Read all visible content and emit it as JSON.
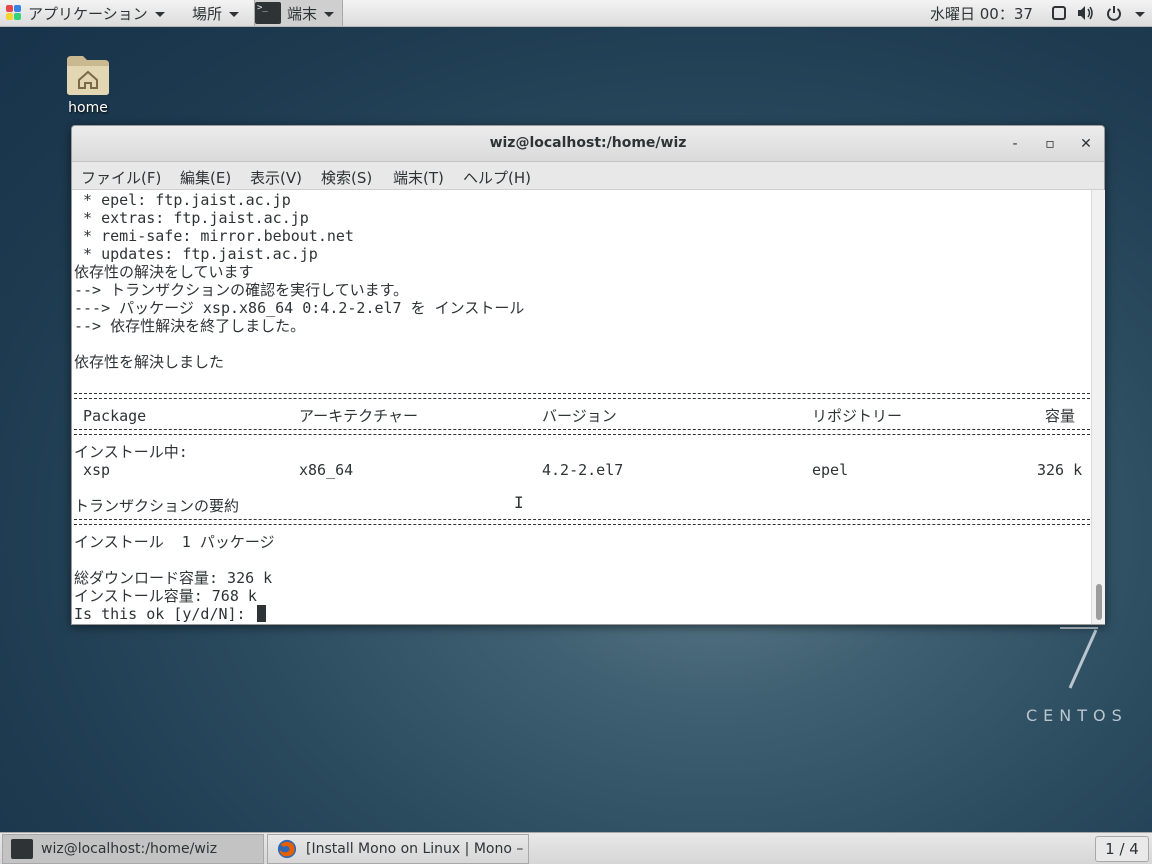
{
  "topbar": {
    "apps_label": "アプリケーション",
    "places_label": "場所",
    "terminal_label": "端末",
    "clock": "水曜日 00：37"
  },
  "desktop": {
    "home_label": "home",
    "centos_label": "CENTOS"
  },
  "window": {
    "title": "wiz@localhost:/home/wiz",
    "menu": [
      "ファイル(F)",
      "編集(E)",
      "表示(V)",
      "検索(S)",
      "端末(T)",
      "ヘルプ(H)"
    ],
    "lines_top": [
      " * epel: ftp.jaist.ac.jp",
      " * extras: ftp.jaist.ac.jp",
      " * remi-safe: mirror.bebout.net",
      " * updates: ftp.jaist.ac.jp",
      "依存性の解決をしています",
      "--> トランザクションの確認を実行しています。",
      "---> パッケージ xsp.x86_64 0:4.2-2.el7 を インストール",
      "--> 依存性解決を終了しました。",
      "",
      "依存性を解決しました"
    ],
    "table": {
      "headers": [
        "Package",
        "アーキテクチャー",
        "バージョン",
        "リポジトリー",
        "容量"
      ],
      "section": "インストール中:",
      "row": [
        "xsp",
        "x86_64",
        "4.2-2.el7",
        "epel",
        "326 k"
      ]
    },
    "summary_title": "トランザクションの要約",
    "install_summary": "インストール  1 パッケージ",
    "download_size": "総ダウンロード容量: 326 k",
    "install_size": "インストール容量: 768 k",
    "prompt": "Is this ok [y/d/N]: "
  },
  "taskbar": {
    "tasks": [
      "wiz@localhost:/home/wiz",
      "[Install Mono on Linux | Mono – M…"
    ],
    "workspace": "1 / 4"
  }
}
